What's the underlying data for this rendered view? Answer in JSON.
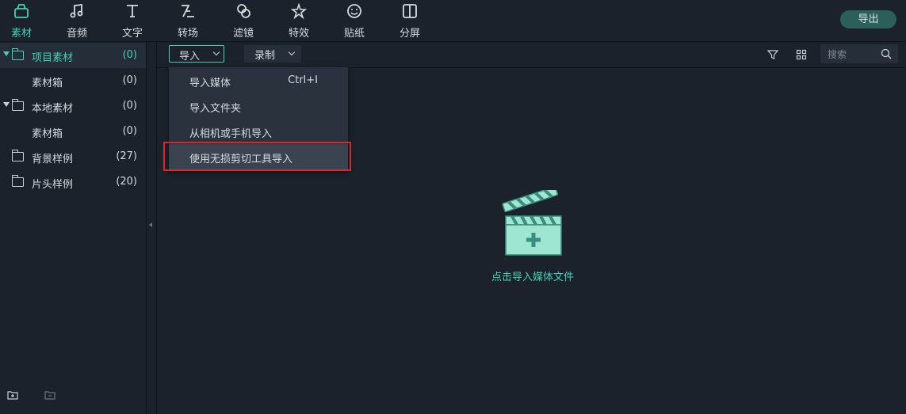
{
  "toolbar": {
    "tabs": [
      {
        "label": "素材",
        "icon": "media-icon",
        "active": true
      },
      {
        "label": "音频",
        "icon": "music-note-icon"
      },
      {
        "label": "文字",
        "icon": "text-icon"
      },
      {
        "label": "转场",
        "icon": "transition-icon"
      },
      {
        "label": "滤镜",
        "icon": "filter-icon"
      },
      {
        "label": "特效",
        "icon": "effects-star-icon"
      },
      {
        "label": "贴纸",
        "icon": "sticker-icon"
      },
      {
        "label": "分屏",
        "icon": "split-screen-icon"
      }
    ],
    "export_label": "导出"
  },
  "sidebar": {
    "items": [
      {
        "name": "项目素材",
        "count": "(0)"
      },
      {
        "name": "素材箱",
        "count": "(0)"
      },
      {
        "name": "本地素材",
        "count": "(0)"
      },
      {
        "name": "素材箱",
        "count": "(0)"
      },
      {
        "name": "背景样例",
        "count": "(27)"
      },
      {
        "name": "片头样例",
        "count": "(20)"
      }
    ]
  },
  "content": {
    "import_label": "导入",
    "record_label": "录制",
    "search_placeholder": "搜索"
  },
  "menu": {
    "items": [
      {
        "label": "导入媒体",
        "shortcut": "Ctrl+I"
      },
      {
        "label": "导入文件夹"
      },
      {
        "label": "从相机或手机导入"
      },
      {
        "label": "使用无损剪切工具导入"
      }
    ]
  },
  "empty_state": {
    "label": "点击导入媒体文件"
  },
  "colors": {
    "accent": "#44d1b6",
    "background": "#1b222b",
    "highlight_border": "#e0242b"
  }
}
